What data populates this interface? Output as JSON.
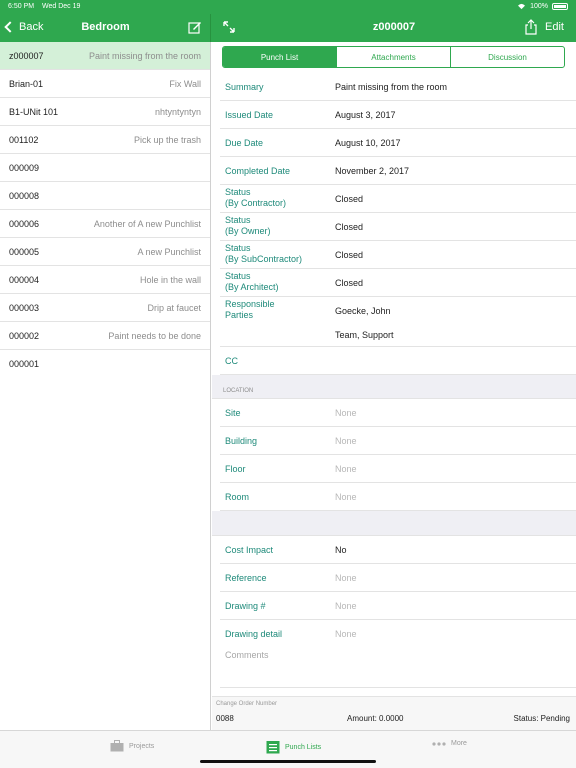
{
  "status_bar": {
    "time": "6:50 PM",
    "date": "Wed Dec 19",
    "battery": "100%"
  },
  "left_nav": {
    "back_label": "Back",
    "title": "Bedroom"
  },
  "right_nav": {
    "title": "z000007",
    "edit_label": "Edit"
  },
  "punch_items": [
    {
      "id": "z000007",
      "desc": "Paint missing from the room",
      "selected": true
    },
    {
      "id": "Brian-01",
      "desc": "Fix Wall"
    },
    {
      "id": "B1-UNit 101",
      "desc": "nhtyntyntyn"
    },
    {
      "id": "001102",
      "desc": "Pick up the trash"
    },
    {
      "id": "000009",
      "desc": ""
    },
    {
      "id": "000008",
      "desc": ""
    },
    {
      "id": "000006",
      "desc": "Another of A new Punchlist"
    },
    {
      "id": "000005",
      "desc": "A new Punchlist"
    },
    {
      "id": "000004",
      "desc": "Hole in the wall"
    },
    {
      "id": "000003",
      "desc": "Drip at faucet"
    },
    {
      "id": "000002",
      "desc": "Paint needs to be done"
    },
    {
      "id": "000001",
      "desc": ""
    }
  ],
  "segments": [
    "Punch List",
    "Attachments",
    "Discussion"
  ],
  "details": {
    "summary": {
      "label": "Summary",
      "value": "Paint missing from the room"
    },
    "issued": {
      "label": "Issued Date",
      "value": "August 3, 2017"
    },
    "due": {
      "label": "Due Date",
      "value": "August 10, 2017"
    },
    "completed": {
      "label": "Completed Date",
      "value": "November 2, 2017"
    },
    "status_contractor": {
      "label1": "Status",
      "label2": "(By Contractor)",
      "value": "Closed"
    },
    "status_owner": {
      "label1": "Status",
      "label2": "(By Owner)",
      "value": "Closed"
    },
    "status_sub": {
      "label1": "Status",
      "label2": "(By SubContractor)",
      "value": "Closed"
    },
    "status_architect": {
      "label1": "Status",
      "label2": "(By Architect)",
      "value": "Closed"
    },
    "responsible": {
      "label1": "Responsible",
      "label2": "Parties",
      "value1": "Goecke, John",
      "value2": "Team, Support"
    },
    "cc": {
      "label": "CC"
    }
  },
  "location": {
    "header": "LOCATION",
    "site": {
      "label": "Site",
      "value": "None"
    },
    "building": {
      "label": "Building",
      "value": "None"
    },
    "floor": {
      "label": "Floor",
      "value": "None"
    },
    "room": {
      "label": "Room",
      "value": "None"
    }
  },
  "extra": {
    "cost_impact": {
      "label": "Cost Impact",
      "value": "No"
    },
    "reference": {
      "label": "Reference",
      "value": "None"
    },
    "drawing_num": {
      "label": "Drawing #",
      "value": "None"
    },
    "drawing_detail": {
      "label": "Drawing detail",
      "value": "None"
    },
    "comments_label": "Comments"
  },
  "change_order": {
    "label": "Change Order Number",
    "number": "0088",
    "amount": "Amount: 0.0000",
    "status": "Status: Pending"
  },
  "tabs": {
    "projects": "Projects",
    "punch_lists": "Punch Lists",
    "more": "More"
  },
  "colors": {
    "brand_green": "#2fa84f",
    "label_teal": "#1e8a7a",
    "selected_row": "#d4f0d8"
  }
}
